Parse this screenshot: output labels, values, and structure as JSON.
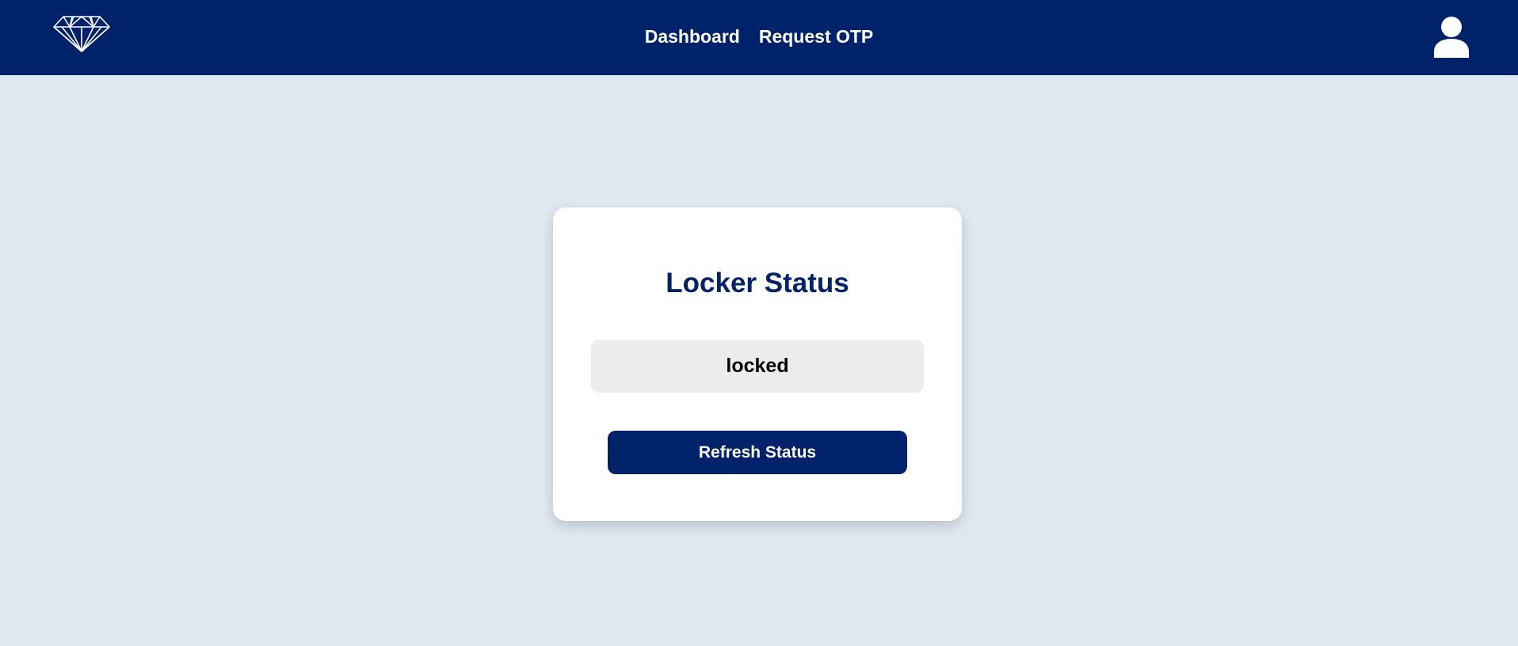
{
  "nav": {
    "logo_icon": "diamond-icon",
    "links": [
      {
        "label": "Dashboard"
      },
      {
        "label": "Request OTP"
      }
    ],
    "avatar_icon": "user-icon"
  },
  "locker": {
    "title": "Locker Status",
    "status": "locked",
    "refresh_label": "Refresh Status"
  },
  "colors": {
    "primary": "#00226b",
    "background": "#dfe7f0",
    "card": "#ffffff",
    "status_box": "#ececec"
  }
}
